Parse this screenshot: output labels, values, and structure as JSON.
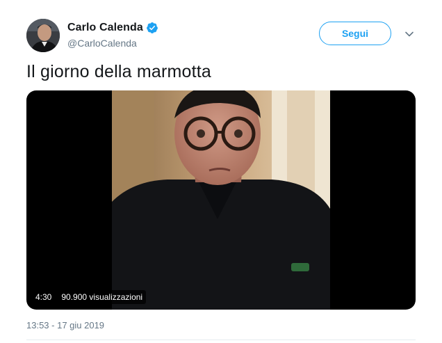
{
  "author": {
    "display_name": "Carlo Calenda",
    "handle": "@CarloCalenda",
    "verified_icon": "verified-badge-icon"
  },
  "actions": {
    "follow_label": "Segui",
    "more_icon": "chevron-down-icon"
  },
  "tweet": {
    "text": "Il giorno della marmotta",
    "timestamp": "13:53 - 17 giu 2019"
  },
  "video": {
    "duration": "4:30",
    "views": "90.900 visualizzazioni"
  },
  "colors": {
    "accent": "#1da1f2",
    "text": "#14171a",
    "muted": "#657786"
  }
}
